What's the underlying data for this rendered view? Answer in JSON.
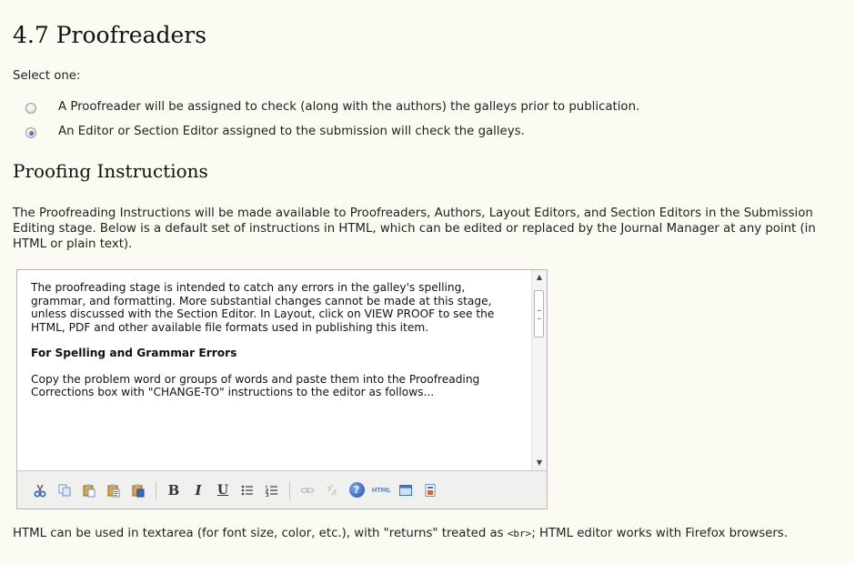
{
  "section": {
    "title": "4.7 Proofreaders",
    "select_label": "Select one:"
  },
  "options": [
    {
      "label": "A Proofreader will be assigned to check (along with the authors) the galleys prior to publication.",
      "checked": false
    },
    {
      "label": "An Editor or Section Editor assigned to the submission will check the galleys.",
      "checked": true
    }
  ],
  "instructions": {
    "title": "Proofing Instructions",
    "description": "The Proofreading Instructions will be made available to Proofreaders, Authors, Layout Editors, and Section Editors in the Submission Editing stage. Below is a default set of instructions in HTML, which can be edited or replaced by the Journal Manager at any point (in HTML or plain text)."
  },
  "editor": {
    "paragraph1": "The proofreading stage is intended to catch any errors in the galley's spelling, grammar, and formatting. More substantial changes cannot be made at this stage, unless discussed with the Section Editor. In Layout, click on VIEW PROOF to see the HTML, PDF and other available file formats used in publishing this item.",
    "heading": "For Spelling and Grammar Errors",
    "paragraph2": "Copy the problem word or groups of words and paste them into the Proofreading Corrections box with \"CHANGE-TO\" instructions to the editor as follows...",
    "toolbar_icons": [
      "cut-icon",
      "copy-icon",
      "paste-icon",
      "paste-text-icon",
      "paste-word-icon",
      "bold-icon",
      "italic-icon",
      "underline-icon",
      "bullet-list-icon",
      "numbered-list-icon",
      "link-icon",
      "unlink-icon",
      "help-icon",
      "html-source-icon",
      "fullscreen-icon",
      "insert-file-icon"
    ],
    "html_label": "HTML",
    "help_label": "?"
  },
  "footer": {
    "text_before": "HTML can be used in textarea (for font size, color, etc.), with \"returns\" treated as ",
    "code": "<br>",
    "text_after": "; HTML editor works with Firefox browsers."
  }
}
